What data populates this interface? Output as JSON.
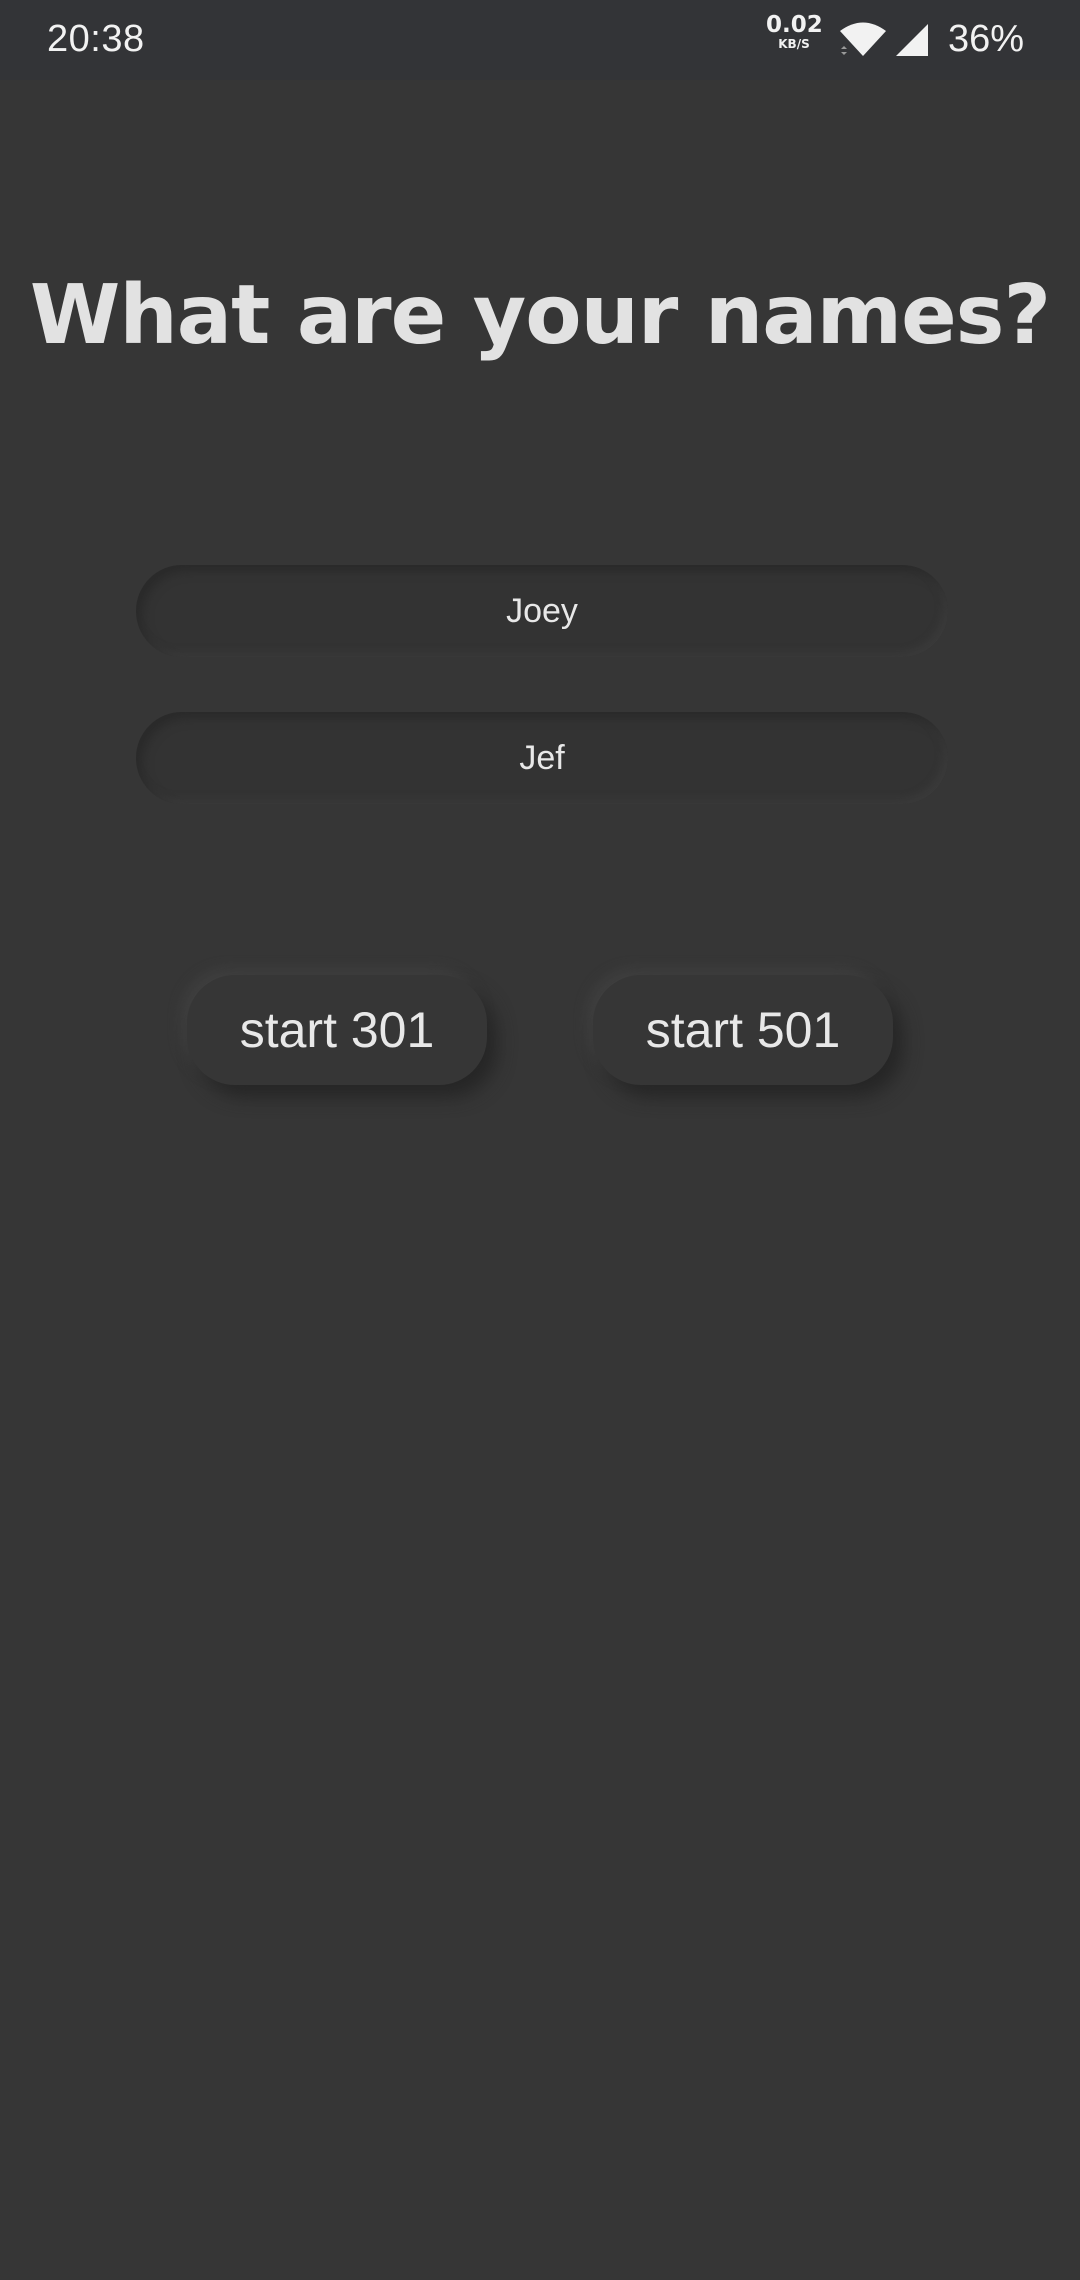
{
  "status_bar": {
    "time": "20:38",
    "net_speed_value": "0.02",
    "net_speed_unit": "KB/S",
    "battery": "36%",
    "icons": [
      "wifi-icon",
      "signal-icon"
    ]
  },
  "title": "What are your names?",
  "players": [
    {
      "value": "Joey"
    },
    {
      "value": "Jef"
    }
  ],
  "buttons": {
    "start_301": "start 301",
    "start_501": "start 501"
  },
  "colors": {
    "background": "#363636",
    "text": "#e6e6e6"
  }
}
